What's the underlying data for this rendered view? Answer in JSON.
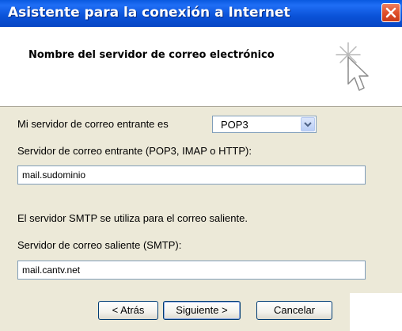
{
  "window": {
    "title": "Asistente para la conexión a Internet"
  },
  "header": {
    "title": "Nombre del servidor de correo electrónico",
    "icon": "wizard-cursor-sparkle-icon"
  },
  "incoming_type": {
    "label": "Mi servidor de correo entrante es",
    "selected": "POP3"
  },
  "incoming_server": {
    "label": "Servidor de correo entrante (POP3, IMAP o HTTP):",
    "value": "mail.sudominio"
  },
  "smtp_note": "El servidor SMTP se utiliza para el correo saliente.",
  "outgoing_server": {
    "label": "Servidor de correo saliente (SMTP):",
    "value": "mail.cantv.net"
  },
  "buttons": {
    "back": "< Atrás",
    "next": "Siguiente >",
    "cancel": "Cancelar"
  },
  "colors": {
    "titlebar": "#0a52d8",
    "dialog_bg": "#ece9d8",
    "close": "#e0502a"
  }
}
